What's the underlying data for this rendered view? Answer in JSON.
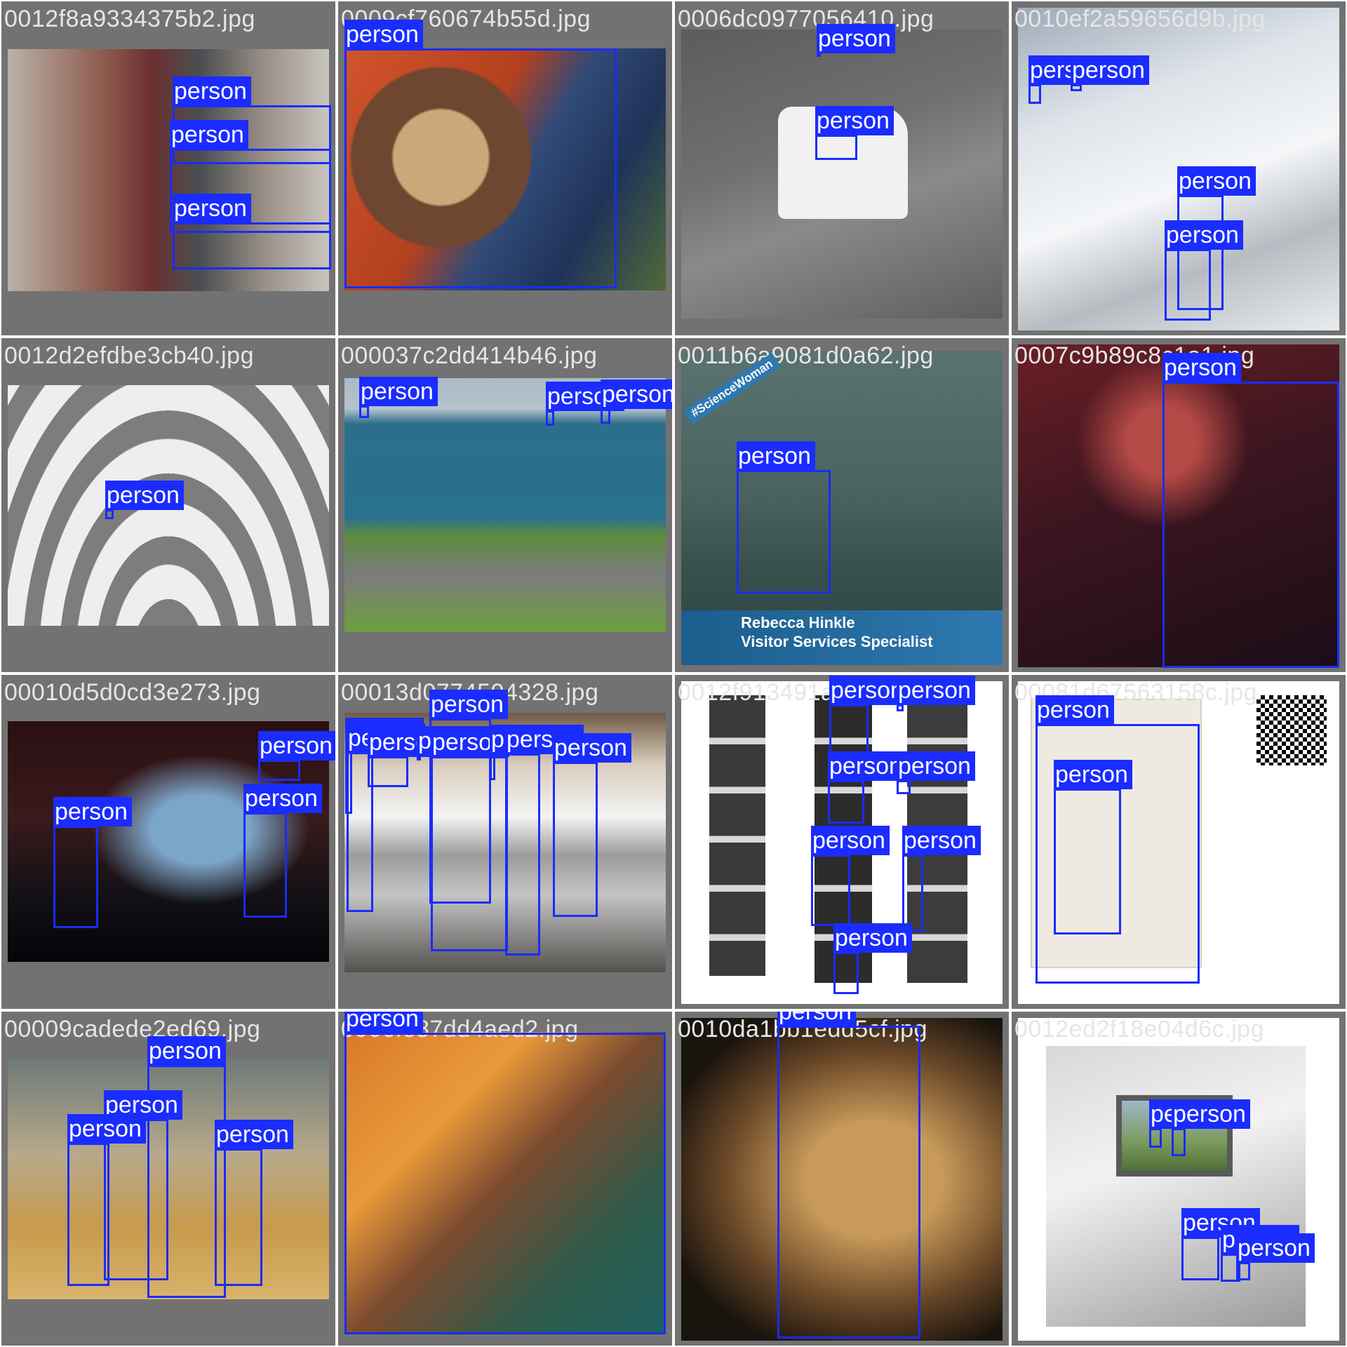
{
  "mosaic": {
    "label_text": "person",
    "colors": {
      "background": "#727272",
      "box": "#1a2cff",
      "label_text": "#ffffff",
      "filename_text": "#e6e6e6"
    },
    "tiles": [
      {
        "filename": "0012f8a9334375b2.jpg"
      },
      {
        "filename": "0009cf760674b55d.jpg"
      },
      {
        "filename": "0006dc0977056410.jpg"
      },
      {
        "filename": "0010ef2a59656d9b.jpg"
      },
      {
        "filename": "0012d2efdbe3cb40.jpg"
      },
      {
        "filename": "000037c2dd414b46.jpg"
      },
      {
        "filename": "0011b6a9081d0a62.jpg",
        "banner": "#ScienceWoman",
        "caption_name": "Rebecca Hinkle",
        "caption_role": "Visitor Services Specialist"
      },
      {
        "filename": "0007c9b89c8c1a1.jpg"
      },
      {
        "filename": "00010d5d0cd3e273.jpg"
      },
      {
        "filename": "00013d0774504328.jpg"
      },
      {
        "filename": "0012f913491a7e1a.jpg"
      },
      {
        "filename": "00081d67563158c.jpg"
      },
      {
        "filename": "00009cadede2ed69.jpg"
      },
      {
        "filename": "0006fe87dd4aed2.jpg"
      },
      {
        "filename": "0010da1bb1edd5cf.jpg"
      },
      {
        "filename": "0012ed2f18e04d6c.jpg"
      }
    ]
  }
}
